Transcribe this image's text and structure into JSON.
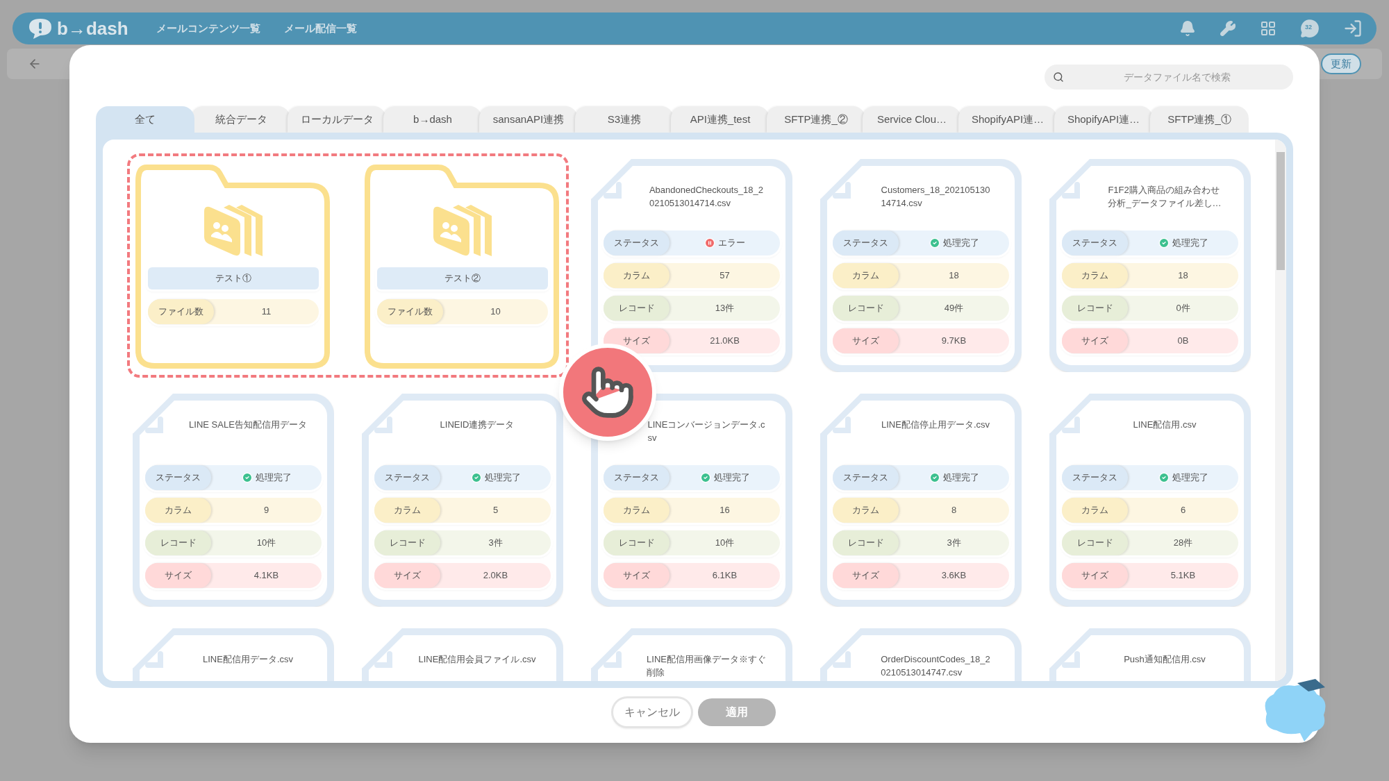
{
  "header": {
    "logo": "b→dash",
    "nav": [
      "メールコンテンツ一覧",
      "メール配信一覧"
    ],
    "badge": "32"
  },
  "subbar": {
    "button": "更新"
  },
  "search": {
    "placeholder": "データファイル名で検索"
  },
  "tabs": [
    {
      "label": "全て",
      "selected": true
    },
    {
      "label": "統合データ",
      "selected": false
    },
    {
      "label": "ローカルデータ",
      "selected": false
    },
    {
      "label": "b→dash",
      "selected": false
    },
    {
      "label": "sansanAPI連携",
      "selected": false
    },
    {
      "label": "S3連携",
      "selected": false
    },
    {
      "label": "API連携_test",
      "selected": false
    },
    {
      "label": "SFTP連携_②",
      "selected": false
    },
    {
      "label": "Service Clou…",
      "selected": false
    },
    {
      "label": "ShopifyAPI連…",
      "selected": false
    },
    {
      "label": "ShopifyAPI連…",
      "selected": false
    },
    {
      "label": "SFTP連携_①",
      "selected": false
    }
  ],
  "items": [
    {
      "kind": "folder",
      "name": "テスト①",
      "fields": [
        {
          "kind": "count",
          "label": "ファイル数",
          "value": "11"
        }
      ]
    },
    {
      "kind": "folder",
      "name": "テスト②",
      "fields": [
        {
          "kind": "count",
          "label": "ファイル数",
          "value": "10"
        }
      ]
    },
    {
      "kind": "file",
      "name": "AbandonedCheckouts_18_2\n0210513014714.csv",
      "fields": [
        {
          "kind": "status",
          "error": true,
          "label": "ステータス",
          "value": "エラー"
        },
        {
          "kind": "column",
          "label": "カラム",
          "value": "57"
        },
        {
          "kind": "record",
          "label": "レコード",
          "value": "13件"
        },
        {
          "kind": "size",
          "label": "サイズ",
          "value": "21.0KB"
        }
      ]
    },
    {
      "kind": "file",
      "name": "Customers_18_202105130\n14714.csv",
      "fields": [
        {
          "kind": "status",
          "error": false,
          "label": "ステータス",
          "value": "処理完了"
        },
        {
          "kind": "column",
          "label": "カラム",
          "value": "18"
        },
        {
          "kind": "record",
          "label": "レコード",
          "value": "49件"
        },
        {
          "kind": "size",
          "label": "サイズ",
          "value": "9.7KB"
        }
      ]
    },
    {
      "kind": "file",
      "name": [
        "F1F2購入商品の組み合わせ",
        "分析_データファイル差し…"
      ],
      "fields": [
        {
          "kind": "status",
          "error": false,
          "label": "ステータス",
          "value": "処理完了"
        },
        {
          "kind": "column",
          "label": "カラム",
          "value": "18"
        },
        {
          "kind": "record",
          "label": "レコード",
          "value": "0件"
        },
        {
          "kind": "size",
          "label": "サイズ",
          "value": "0B"
        }
      ]
    },
    {
      "kind": "file",
      "name": "LINE SALE告知配信用データ",
      "fields": [
        {
          "kind": "status",
          "error": false,
          "label": "ステータス",
          "value": "処理完了"
        },
        {
          "kind": "column",
          "label": "カラム",
          "value": "9"
        },
        {
          "kind": "record",
          "label": "レコード",
          "value": "10件"
        },
        {
          "kind": "size",
          "label": "サイズ",
          "value": "4.1KB"
        }
      ]
    },
    {
      "kind": "file",
      "name": "LINEID連携データ",
      "fields": [
        {
          "kind": "status",
          "error": false,
          "label": "ステータス",
          "value": "処理完了"
        },
        {
          "kind": "column",
          "label": "カラム",
          "value": "5"
        },
        {
          "kind": "record",
          "label": "レコード",
          "value": "3件"
        },
        {
          "kind": "size",
          "label": "サイズ",
          "value": "2.0KB"
        }
      ]
    },
    {
      "kind": "file",
      "name": "LINEコンバージョンデータ.c\nsv",
      "fields": [
        {
          "kind": "status",
          "error": false,
          "label": "ステータス",
          "value": "処理完了"
        },
        {
          "kind": "column",
          "label": "カラム",
          "value": "16"
        },
        {
          "kind": "record",
          "label": "レコード",
          "value": "10件"
        },
        {
          "kind": "size",
          "label": "サイズ",
          "value": "6.1KB"
        }
      ]
    },
    {
      "kind": "file",
      "name": "LINE配信停止用データ.csv",
      "fields": [
        {
          "kind": "status",
          "error": false,
          "label": "ステータス",
          "value": "処理完了"
        },
        {
          "kind": "column",
          "label": "カラム",
          "value": "8"
        },
        {
          "kind": "record",
          "label": "レコード",
          "value": "3件"
        },
        {
          "kind": "size",
          "label": "サイズ",
          "value": "3.6KB"
        }
      ]
    },
    {
      "kind": "file",
      "name": "LINE配信用.csv",
      "fields": [
        {
          "kind": "status",
          "error": false,
          "label": "ステータス",
          "value": "処理完了"
        },
        {
          "kind": "column",
          "label": "カラム",
          "value": "6"
        },
        {
          "kind": "record",
          "label": "レコード",
          "value": "28件"
        },
        {
          "kind": "size",
          "label": "サイズ",
          "value": "5.1KB"
        }
      ]
    },
    {
      "kind": "file",
      "name": "LINE配信用データ.csv"
    },
    {
      "kind": "file",
      "name": "LINE配信用会員ファイル.csv"
    },
    {
      "kind": "file",
      "name": [
        "LINE配信用画像データ※すぐ",
        "削除"
      ]
    },
    {
      "kind": "file",
      "name": "OrderDiscountCodes_18_2\n0210513014747.csv"
    },
    {
      "kind": "file",
      "name": "Push通知配信用.csv"
    }
  ],
  "buttons": [
    {
      "label": "キャンセル",
      "disabled": false
    },
    {
      "label": "適用",
      "disabled": true
    }
  ]
}
